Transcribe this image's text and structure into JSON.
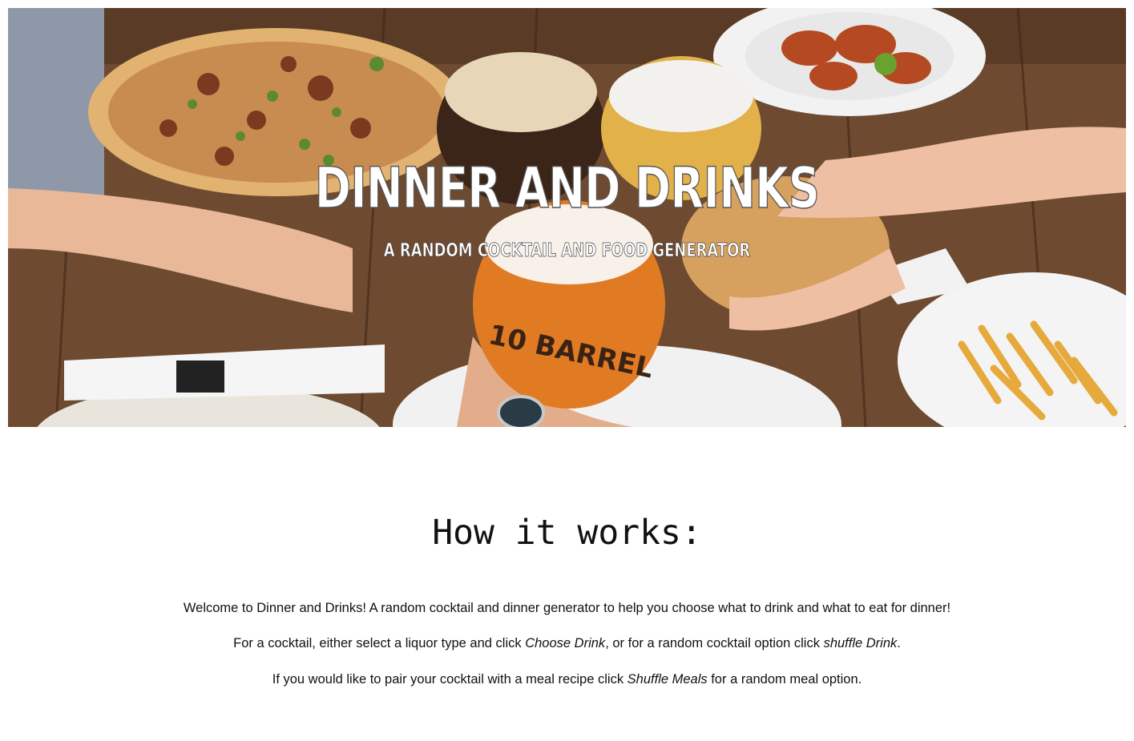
{
  "hero": {
    "title": "DINNER AND DRINKS",
    "subtitle": "A RANDOM COCKTAIL AND FOOD GENERATOR",
    "image_icon": "cheers-beer-food-photo"
  },
  "how_it_works": {
    "heading": "How it works:",
    "p1": "Welcome to Dinner and Drinks! A random cocktail and dinner generator to help you choose what to drink and what to eat for dinner!",
    "p2_before": "For a cocktail, either select a liquor type and click ",
    "p2_choose": "Choose Drink",
    "p2_middle": ", or for a random cocktail option click ",
    "p2_shuffle": "shuffle Drink",
    "p2_end": ".",
    "p3_before": "If you would like to pair your cocktail with a meal recipe click ",
    "p3_shuffle": "Shuffle Meals",
    "p3_end": " for a random meal option."
  }
}
